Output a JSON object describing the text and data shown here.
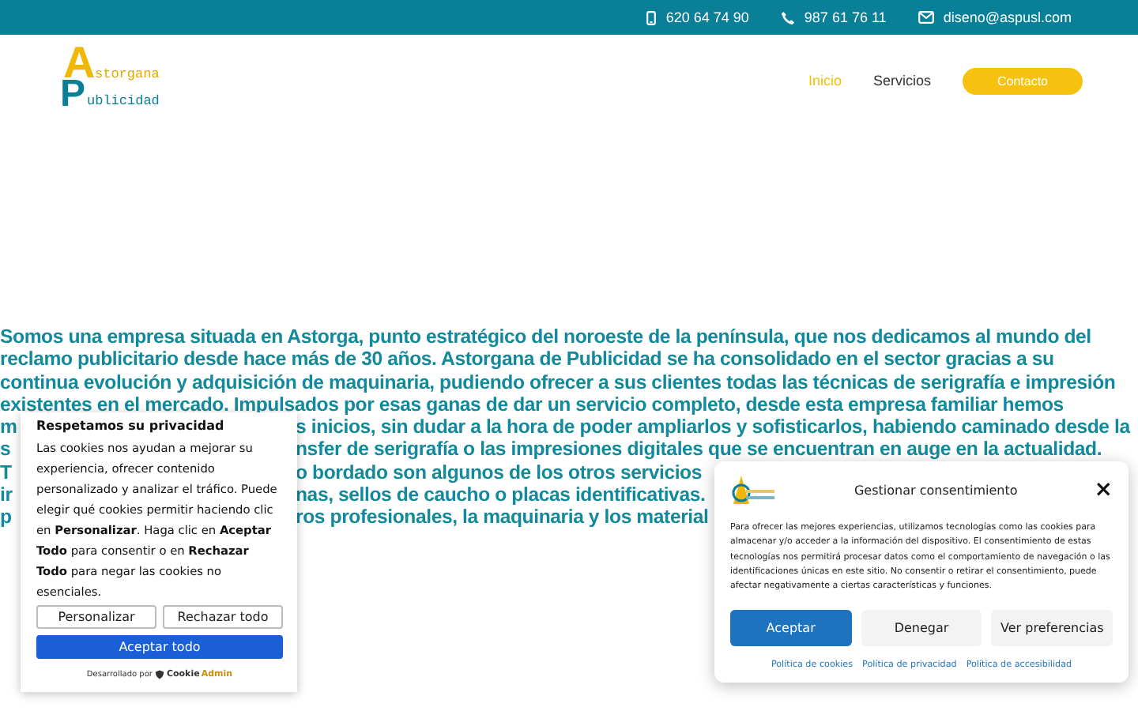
{
  "top_bar": {
    "contacts": [
      {
        "kind": "mobile",
        "text": "620 64 74 90"
      },
      {
        "kind": "phone",
        "text": "987 61 76 11"
      },
      {
        "kind": "mail",
        "text": "diseno@aspusl.com"
      }
    ]
  },
  "logo": {
    "initial_top": "A",
    "word_top": "storgana",
    "initial_bottom": "P",
    "word_bottom": "ublicidad"
  },
  "nav": {
    "items": [
      {
        "label": "Inicio",
        "selected": true
      },
      {
        "label": "Servicios",
        "selected": false
      }
    ],
    "cta": "Contacto"
  },
  "intro": {
    "lines": [
      {
        "kind": "full",
        "text": "Somos una empresa situada en Astorga, punto estratégico del noroeste de la península, que nos dedicamos al mundo del"
      },
      {
        "kind": "full",
        "text": "reclamo publicitario desde hace más de 30 años. Astorgana de Publicidad se ha consolidado en el sector gracias a su"
      },
      {
        "kind": "full",
        "text": "continua evolución y adquisición de maquinaria, pudiendo ofrecer a sus clientes todas las técnicas de serigrafía e impresión"
      },
      {
        "kind": "full",
        "text": "existentes en el mercado. Impulsados por esas ganas de dar un servicio completo, desde esta empresa familiar hemos"
      },
      {
        "kind": "split",
        "left": "m",
        "right": "s inicios, sin dudar a la hora de poder ampliarlos y sofisticarlos, habiendo caminado desde la"
      },
      {
        "kind": "split",
        "left": "s",
        "right": "nsfer de serigrafía o las impresiones digitales que se encuentran en auge en la actualidad."
      },
      {
        "kind": "split",
        "left": "T",
        "right": "o bordado son algunos de los otros servicios"
      },
      {
        "kind": "split",
        "left": "ir",
        "right": "nas, sellos de caucho o placas identificativas."
      },
      {
        "kind": "split",
        "left": "p",
        "right": "ros profesionales, la maquinaria y los material"
      }
    ]
  },
  "cookie_notice": {
    "title": "Respetamos su privacidad",
    "text": "Las cookies nos ayudan a mejorar su experiencia, ofrecer contenido personalizado y analizar el tráfico. Puede elegir qué cookies permitir haciendo clic en **Personalizar**. Haga clic en **Aceptar Todo** para consentir o en **Rechazar Todo** para negar las cookies no esenciales.",
    "buttons": [
      {
        "kind": "secondary",
        "label": "Personalizar"
      },
      {
        "kind": "secondary",
        "label": "Rechazar todo"
      },
      {
        "kind": "primary",
        "label": "Aceptar todo"
      }
    ],
    "credit": "Desarrollado por",
    "brand_a": "Cookie",
    "brand_b": "Admin"
  },
  "consent_dialog": {
    "title": "Gestionar consentimiento",
    "close": "×",
    "text": "Para ofrecer las mejores experiencias, utilizamos tecnologías como las cookies para almacenar y/o acceder a la información del dispositivo. El consentimiento de estas tecnologías nos permitirá procesar datos como el comportamiento de navegación o las identificaciones únicas en este sitio. No consentir o retirar el consentimiento, puede afectar negativamente a ciertas características y funciones.",
    "buttons": [
      {
        "kind": "primary",
        "label": "Aceptar"
      },
      {
        "kind": "secondary",
        "label": "Denegar"
      },
      {
        "kind": "secondary",
        "label": "Ver preferencias"
      }
    ],
    "links": [
      "Política de cookies",
      "Política de privacidad",
      "Política de accesibilidad"
    ]
  }
}
